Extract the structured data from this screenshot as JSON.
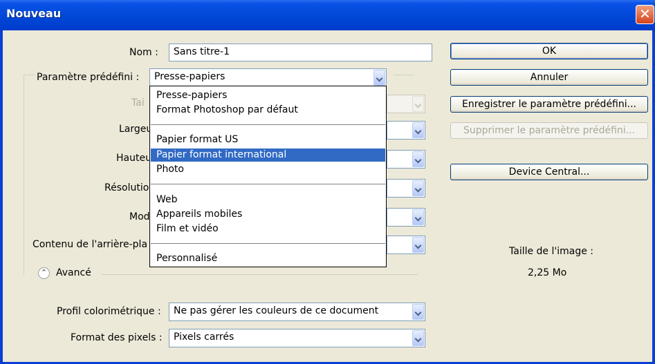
{
  "window": {
    "title": "Nouveau",
    "close_glyph": "✕"
  },
  "form": {
    "nom_label": "Nom :",
    "nom_value": "Sans titre-1",
    "preset_label": "Paramètre prédéfini :",
    "preset_value": "Presse-papiers",
    "taille_label": "Tai",
    "largeur_label": "Largeu",
    "hauteur_label": "Hauteu",
    "resolution_label": "Résolutio",
    "mode_label": "Mod",
    "contenu_label": "Contenu de l'arrière-pla",
    "advanced_label": "Avancé",
    "profil_label": "Profil colorimétrique :",
    "profil_value": "Ne pas gérer les couleurs de ce document",
    "pixels_label": "Format des pixels :",
    "pixels_value": "Pixels carrés"
  },
  "dropdown": {
    "items": [
      "Presse-papiers",
      "Format Photoshop par défaut",
      "Papier format US",
      "Papier format international",
      "Photo",
      "Web",
      "Appareils mobiles",
      "Film et vidéo",
      "Personnalisé"
    ],
    "selected_index": 3
  },
  "buttons": {
    "ok": "OK",
    "cancel": "Annuler",
    "save_preset": "Enregistrer le paramètre prédéfini...",
    "delete_preset": "Supprimer le paramètre prédéfini...",
    "device_central": "Device Central..."
  },
  "info": {
    "image_size_label": "Taille de l'image :",
    "image_size_value": "2,25 Mo"
  },
  "colors": {
    "titlebar": "#0046d6",
    "dialog_bg": "#ece9d8",
    "selection": "#316ac5"
  }
}
